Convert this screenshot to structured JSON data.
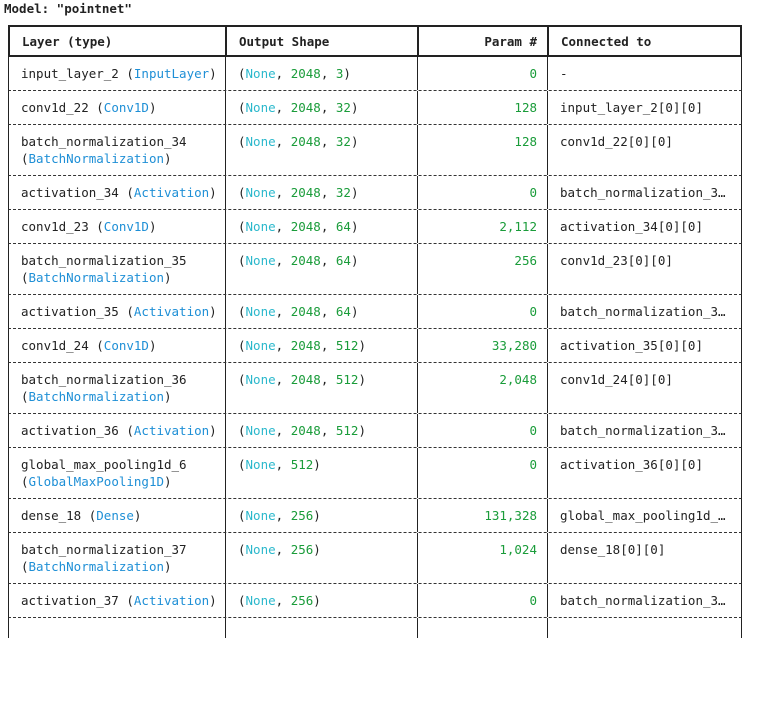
{
  "title": "Model: \"pointnet\"",
  "headers": {
    "layer": "Layer (type)",
    "shape": "Output Shape",
    "param": "Param #",
    "connected": "Connected to"
  },
  "rows": [
    {
      "name": "input_layer_2",
      "type": "InputLayer",
      "shape_dims": "2048, 3",
      "params": "0",
      "connected": "-"
    },
    {
      "name": "conv1d_22",
      "type": "Conv1D",
      "shape_dims": "2048, 32",
      "params": "128",
      "connected": "input_layer_2[0][0]"
    },
    {
      "name": "batch_normalization_34",
      "type": "BatchNormalization",
      "shape_dims": "2048, 32",
      "params": "128",
      "connected": "conv1d_22[0][0]"
    },
    {
      "name": "activation_34",
      "type": "Activation",
      "shape_dims": "2048, 32",
      "params": "0",
      "connected": "batch_normalization_3…"
    },
    {
      "name": "conv1d_23",
      "type": "Conv1D",
      "shape_dims": "2048, 64",
      "params": "2,112",
      "connected": "activation_34[0][0]"
    },
    {
      "name": "batch_normalization_35",
      "type": "BatchNormalization",
      "shape_dims": "2048, 64",
      "params": "256",
      "connected": "conv1d_23[0][0]"
    },
    {
      "name": "activation_35",
      "type": "Activation",
      "shape_dims": "2048, 64",
      "params": "0",
      "connected": "batch_normalization_3…"
    },
    {
      "name": "conv1d_24",
      "type": "Conv1D",
      "shape_dims": "2048, 512",
      "params": "33,280",
      "connected": "activation_35[0][0]"
    },
    {
      "name": "batch_normalization_36",
      "type": "BatchNormalization",
      "shape_dims": "2048, 512",
      "params": "2,048",
      "connected": "conv1d_24[0][0]"
    },
    {
      "name": "activation_36",
      "type": "Activation",
      "shape_dims": "2048, 512",
      "params": "0",
      "connected": "batch_normalization_3…"
    },
    {
      "name": "global_max_pooling1d_6",
      "type": "GlobalMaxPooling1D",
      "shape_dims": "512",
      "params": "0",
      "connected": "activation_36[0][0]"
    },
    {
      "name": "dense_18",
      "type": "Dense",
      "shape_dims": "256",
      "params": "131,328",
      "connected": "global_max_pooling1d_…"
    },
    {
      "name": "batch_normalization_37",
      "type": "BatchNormalization",
      "shape_dims": "256",
      "params": "1,024",
      "connected": "dense_18[0][0]"
    },
    {
      "name": "activation_37",
      "type": "Activation",
      "shape_dims": "256",
      "params": "0",
      "connected": "batch_normalization_3…"
    }
  ],
  "none_token": "None",
  "colors": {
    "layer_type": "#1e8fd6",
    "none": "#2bb8cc",
    "number": "#1a9c3a",
    "text": "#222222"
  }
}
